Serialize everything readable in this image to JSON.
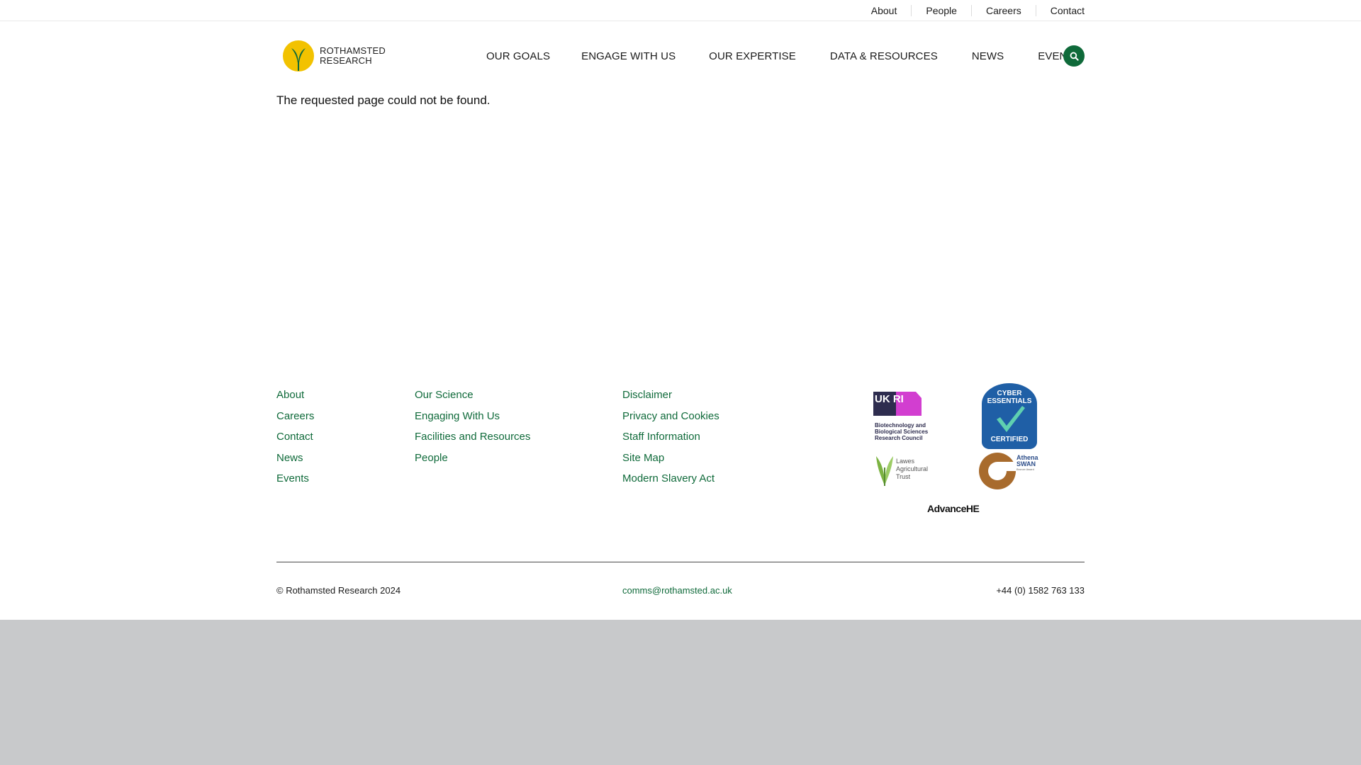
{
  "utility_nav": [
    "About",
    "People",
    "Careers",
    "Contact"
  ],
  "logo": {
    "line1": "ROTHAMSTED",
    "line2": "RESEARCH"
  },
  "main_nav": [
    "OUR GOALS",
    "ENGAGE WITH US",
    "OUR EXPERTISE",
    "DATA & RESOURCES",
    "NEWS",
    "EVENTS"
  ],
  "search": {
    "icon": "search-icon"
  },
  "content": {
    "message": "The requested page could not be found."
  },
  "footer": {
    "col1": [
      "About",
      "Careers",
      "Contact",
      "News",
      "Events"
    ],
    "col2": [
      "Our Science",
      "Engaging With Us",
      "Facilities and Resources",
      "People"
    ],
    "col3": [
      "Disclaimer",
      "Privacy and Cookies",
      "Staff Information",
      "Site Map",
      "Modern Slavery Act"
    ],
    "partner_logos": {
      "ukri_mark": "UK RI",
      "ukri_text": [
        "Biotechnology and",
        "Biological Sciences",
        "Research Council"
      ],
      "cyber_top": [
        "CYBER",
        "ESSENTIALS"
      ],
      "cyber_bottom": "CERTIFIED",
      "lawes_text": [
        "Lawes",
        "Agricultural",
        "Trust"
      ],
      "athena_text": [
        "Athena",
        "SWAN"
      ],
      "athena_small": "Bronze Award",
      "advance_he": "AdvanceHE"
    },
    "copyright": "© Rothamsted Research 2024",
    "email": "comms@rothamsted.ac.uk",
    "phone": "+44 (0) 1582 763 133"
  },
  "colors": {
    "brand_green": "#0f6a3a",
    "logo_yellow": "#f2c200",
    "below_page_grey": "#c8c9cb"
  }
}
